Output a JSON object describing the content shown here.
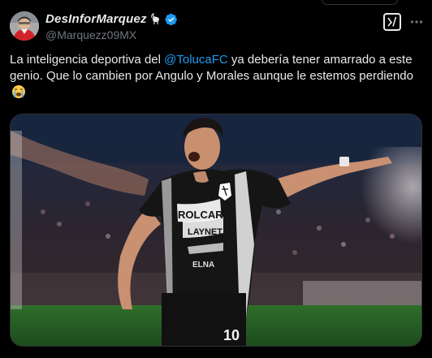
{
  "author": {
    "display_name": "DesInforMarquez",
    "handle": "@Marquezz09MX",
    "goat_icon": "goat-emoji-icon",
    "verified_icon": "verified-badge-icon"
  },
  "actions": {
    "grok_icon": "grok-icon",
    "more_icon": "more-options-icon"
  },
  "tweet": {
    "text_before": "La inteligencia deportiva del ",
    "mention": "@TolucaFC",
    "text_after": " ya debería tener amarrado a este genio. Que lo cambien por Angulo y Morales aunque le estemos perdiendo",
    "emoji": "loudly-crying-face-icon"
  },
  "media": {
    "jersey_sponsor": "ROLCAR",
    "jersey_text_2": "LAYNET",
    "jersey_number": "10",
    "jersey_text_3": "ELNA"
  },
  "colors": {
    "background": "#000000",
    "text": "#e7e9ea",
    "secondary": "#71767b",
    "link": "#1d9bf0",
    "verified": "#1d9bf0"
  }
}
